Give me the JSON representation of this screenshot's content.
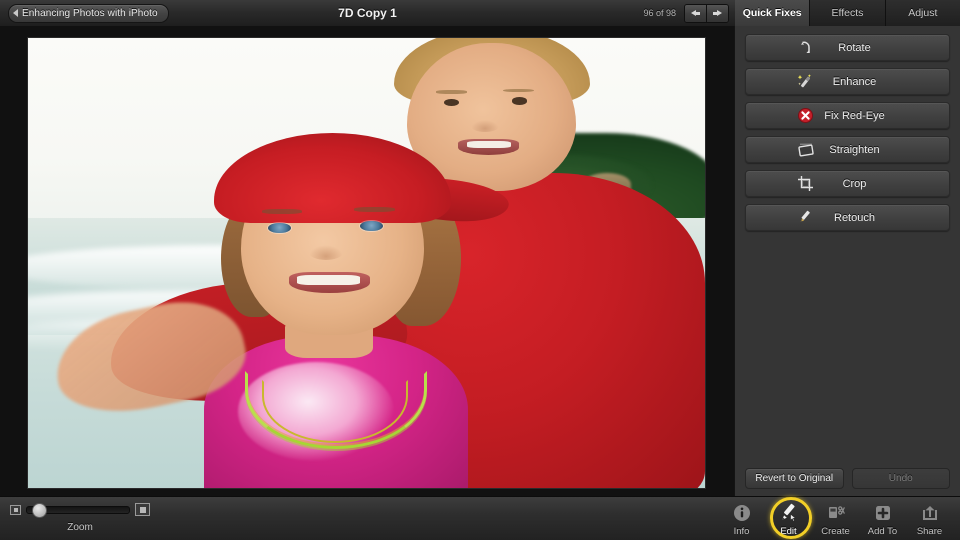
{
  "topbar": {
    "breadcrumb_label": "Enhancing Photos with iPhoto",
    "back_icon": "back-arrow-icon",
    "document_title": "7D Copy 1",
    "photo_count": "96 of 98",
    "prev_icon": "arrow-left-icon",
    "next_icon": "arrow-right-icon"
  },
  "tabs": [
    {
      "label": "Quick Fixes",
      "active": true
    },
    {
      "label": "Effects",
      "active": false
    },
    {
      "label": "Adjust",
      "active": false
    }
  ],
  "quick_fixes": [
    {
      "label": "Rotate",
      "icon": "rotate-icon"
    },
    {
      "label": "Enhance",
      "icon": "magic-wand-icon"
    },
    {
      "label": "Fix Red-Eye",
      "icon": "red-eye-icon"
    },
    {
      "label": "Straighten",
      "icon": "straighten-icon"
    },
    {
      "label": "Crop",
      "icon": "crop-icon"
    },
    {
      "label": "Retouch",
      "icon": "retouch-pencil-icon"
    }
  ],
  "panel_actions": {
    "revert_label": "Revert to Original",
    "undo_label": "Undo",
    "undo_disabled": true
  },
  "zoom_control": {
    "label": "Zoom",
    "min_icon": "small-image-icon",
    "max_icon": "large-image-icon",
    "value_percent": 4
  },
  "bottom_tools": [
    {
      "label": "Info",
      "icon": "info-circle-icon",
      "active": false
    },
    {
      "label": "Edit",
      "icon": "edit-pencil-icon",
      "active": true
    },
    {
      "label": "Create",
      "icon": "create-project-icon",
      "active": false
    },
    {
      "label": "Add To",
      "icon": "plus-square-icon",
      "active": false
    },
    {
      "label": "Share",
      "icon": "share-arrow-icon",
      "active": false
    }
  ],
  "colors": {
    "panel_bg": "#353535",
    "highlight_ring": "#f2cf27",
    "active_tab_bg": "#4b4b4b",
    "red_eye_badge": "#c4202a"
  },
  "photo": {
    "description": "Two smiling children on a tropical beach; a young girl in a red cap, pink tie-dye shirt and green beaded necklace in front, an older boy in a red t-shirt behind her."
  }
}
